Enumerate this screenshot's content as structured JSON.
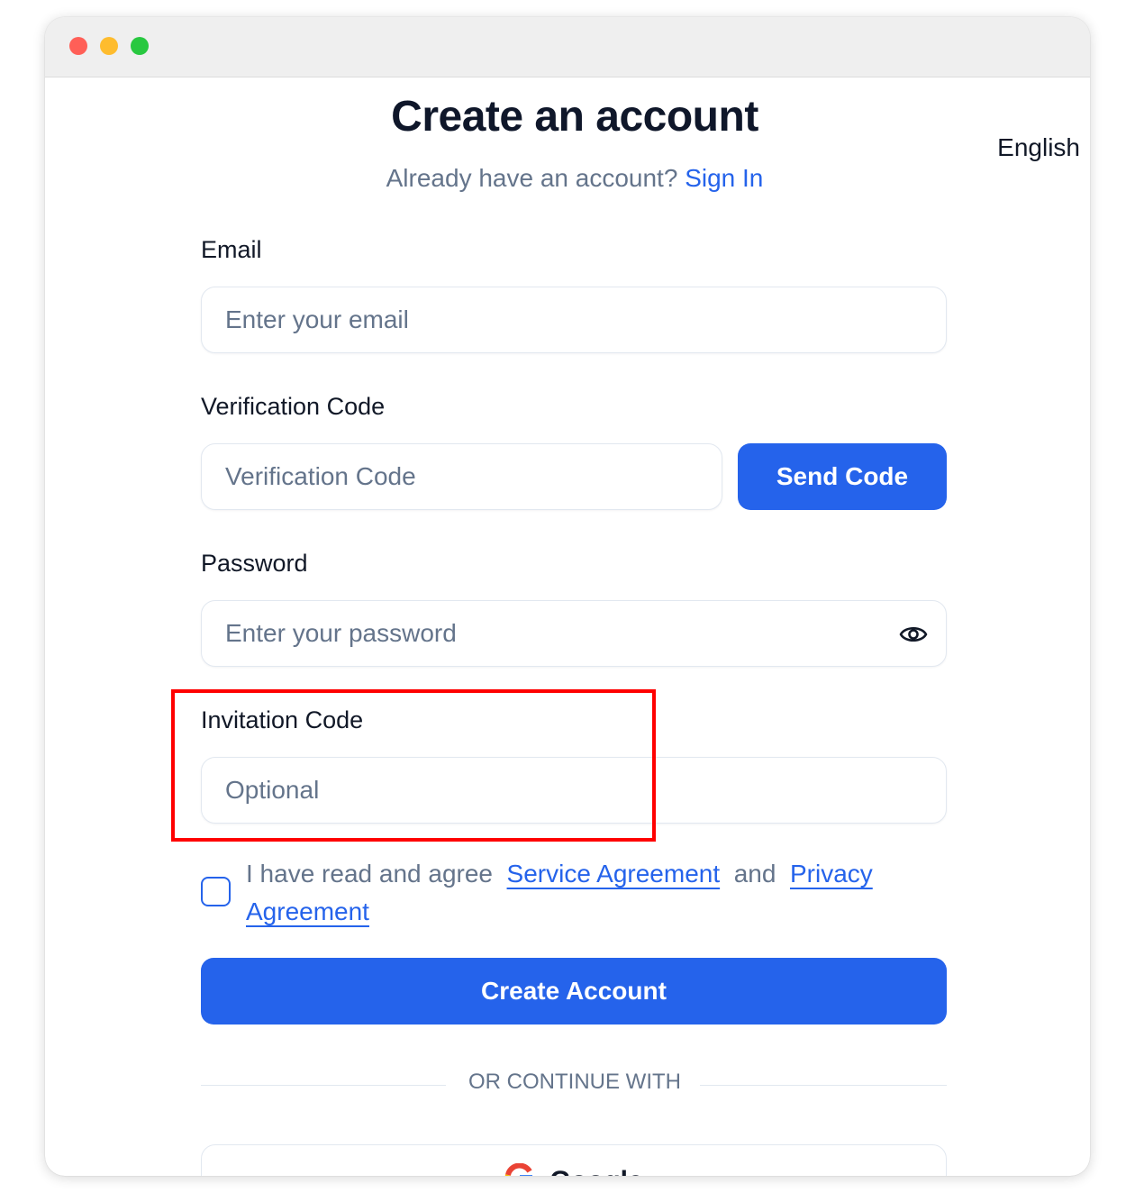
{
  "window": {
    "traffic_lights": [
      {
        "name": "close",
        "color": "#ff5f57"
      },
      {
        "name": "minimize",
        "color": "#febc2e"
      },
      {
        "name": "maximize",
        "color": "#28c840"
      }
    ]
  },
  "header": {
    "title": "Create an account",
    "language": "English",
    "have_account_text": "Already have an account?",
    "sign_in_link": "Sign In"
  },
  "form": {
    "email": {
      "label": "Email",
      "placeholder": "Enter your email",
      "value": ""
    },
    "verification": {
      "label": "Verification Code",
      "placeholder": "Verification Code",
      "value": "",
      "send_button": "Send Code"
    },
    "password": {
      "label": "Password",
      "placeholder": "Enter your password",
      "value": "",
      "toggle_icon": "eye-icon"
    },
    "invitation": {
      "label": "Invitation Code",
      "placeholder": "Optional",
      "value": ""
    },
    "agreement": {
      "checked": false,
      "prefix": "I have read and agree",
      "service_link": "Service Agreement",
      "conjunction": "and",
      "privacy_link": "Privacy Agreement"
    },
    "submit_label": "Create Account"
  },
  "divider": {
    "text": "OR CONTINUE WITH"
  },
  "social": {
    "google_label": "Google",
    "google_icon": "google-icon"
  },
  "colors": {
    "accent": "#2563eb",
    "highlight": "#ff0000",
    "muted_text": "#64748b",
    "heading": "#0f172a"
  }
}
